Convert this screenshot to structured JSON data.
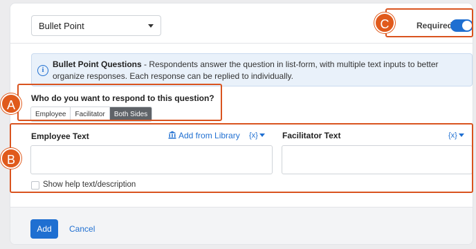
{
  "question_type": {
    "selected": "Bullet Point"
  },
  "required": {
    "label": "Required",
    "on": true
  },
  "info": {
    "title": "Bullet Point Questions",
    "body": " - Respondents answer the question in list-form, with multiple text inputs to better organize responses. Each response can be replied to individually."
  },
  "respond": {
    "label": "Who do you want to respond to this question?",
    "options": [
      "Employee",
      "Facilitator",
      "Both Sides"
    ],
    "selected": "Both Sides"
  },
  "employee_text": {
    "label": "Employee Text",
    "library_link": "Add from Library",
    "variable": "{x}"
  },
  "facilitator_text": {
    "label": "Facilitator Text",
    "variable": "{x}"
  },
  "help_text": {
    "label": "Show help text/description",
    "checked": false
  },
  "footer": {
    "add": "Add",
    "cancel": "Cancel"
  },
  "callouts": [
    "A",
    "B",
    "C"
  ],
  "colors": {
    "accent": "#1f6fd1",
    "callout": "#e05a1c"
  }
}
